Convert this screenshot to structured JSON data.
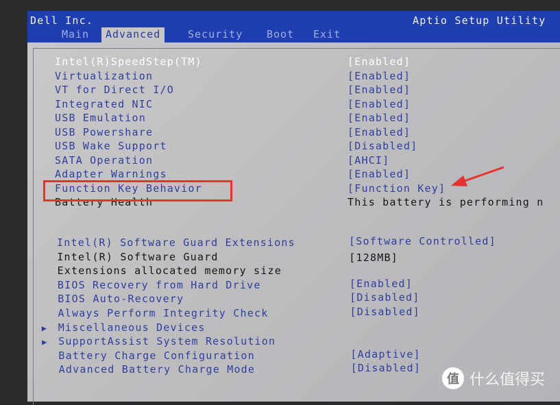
{
  "header": {
    "vendor": "Dell Inc.",
    "utility": "Aptio Setup Utility"
  },
  "tabs": [
    {
      "label": "Main"
    },
    {
      "label": "Advanced",
      "active": true
    },
    {
      "label": "Security"
    },
    {
      "label": "Boot"
    },
    {
      "label": "Exit"
    }
  ],
  "group1": [
    {
      "label": "Intel(R)SpeedStep(TM)",
      "value": "[Enabled]"
    },
    {
      "label": "Virtualization",
      "value": "[Enabled]"
    },
    {
      "label": "VT for Direct I/O",
      "value": "[Enabled]"
    },
    {
      "label": "Integrated NIC",
      "value": "[Enabled]"
    },
    {
      "label": "USB Emulation",
      "value": "[Enabled]"
    },
    {
      "label": "USB Powershare",
      "value": "[Enabled]"
    },
    {
      "label": "USB Wake Support",
      "value": "[Disabled]"
    },
    {
      "label": "SATA Operation",
      "value": "[AHCI]"
    },
    {
      "label": "Adapter Warnings",
      "value": "[Enabled]"
    },
    {
      "label": "Function Key Behavior",
      "value": "[Function Key]"
    },
    {
      "label": "Battery Health",
      "value": "This battery is performing n"
    }
  ],
  "group2": [
    {
      "label": "Intel(R) Software Guard Extensions",
      "value": "[Software Controlled]"
    },
    {
      "label": "Intel(R) Software Guard",
      "value": "[128MB]"
    },
    {
      "label": "Extensions allocated memory size",
      "value": ""
    },
    {
      "label": "BIOS Recovery from Hard Drive",
      "value": "[Enabled]"
    },
    {
      "label": "BIOS Auto-Recovery",
      "value": "[Disabled]"
    },
    {
      "label": "Always Perform Integrity Check",
      "value": "[Disabled]"
    },
    {
      "label": "Miscellaneous Devices",
      "value": "",
      "submenu": true
    },
    {
      "label": "SupportAssist System Resolution",
      "value": "",
      "submenu": true
    },
    {
      "label": "Battery Charge Configuration",
      "value": "[Adaptive]"
    },
    {
      "label": "Advanced Battery Charge Mode",
      "value": "[Disabled]"
    }
  ],
  "annotation": {
    "highlight_color": "#e8322e"
  },
  "watermark": {
    "logo": "值",
    "text": "什么值得买"
  },
  "colors": {
    "header": "#1f3fb0",
    "selectable_text": "#2f3e9e",
    "background": "#c6c6c8"
  }
}
